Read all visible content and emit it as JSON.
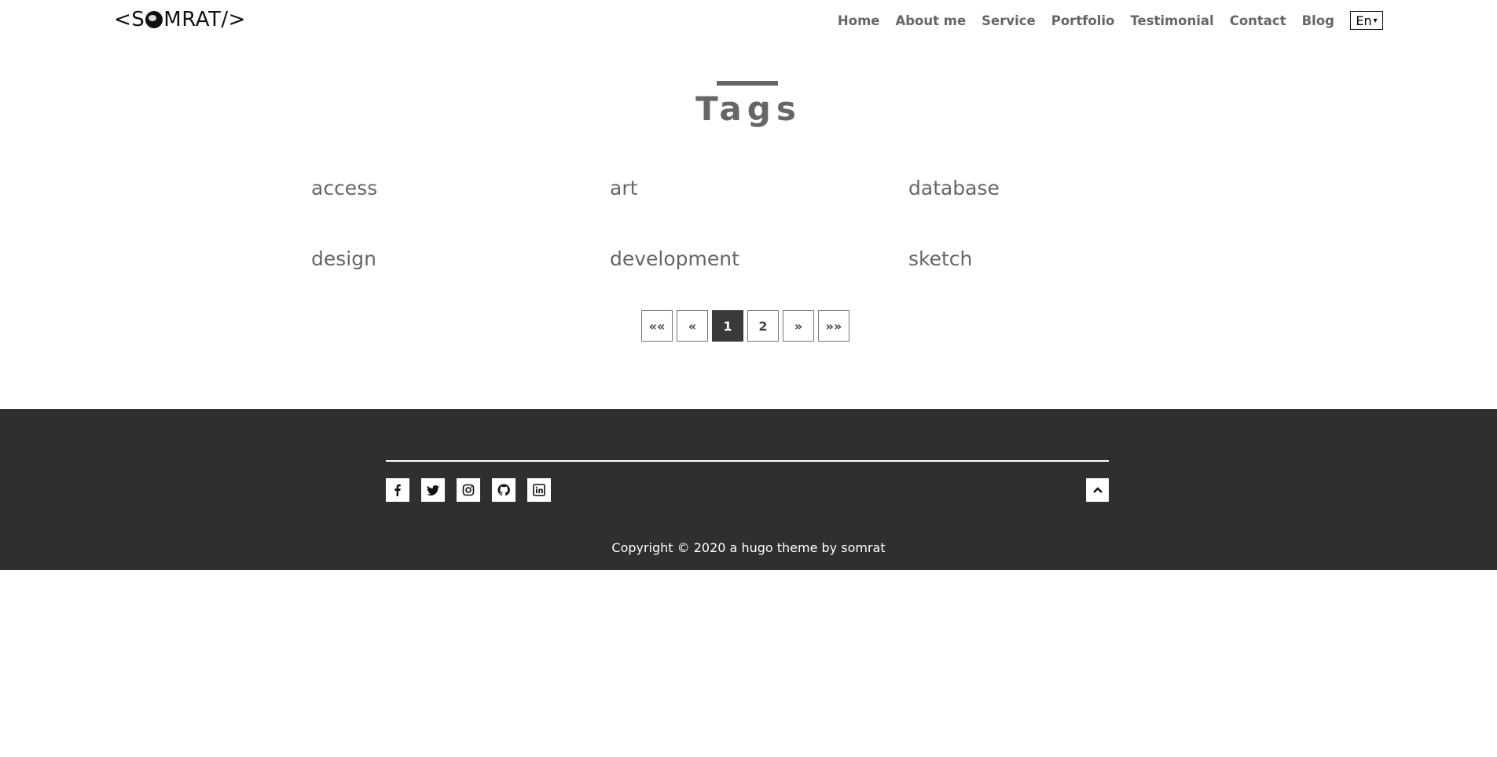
{
  "header": {
    "logo_left": "<S",
    "logo_right": "MRAT/>",
    "nav": [
      "Home",
      "About me",
      "Service",
      "Portfolio",
      "Testimonial",
      "Contact",
      "Blog"
    ],
    "language": "En"
  },
  "main": {
    "title": "Tags",
    "tags": [
      "access",
      "art",
      "database",
      "design",
      "development",
      "sketch"
    ]
  },
  "pagination": {
    "first": "««",
    "prev": "«",
    "pages": [
      "1",
      "2"
    ],
    "current": "1",
    "next": "»",
    "last": "»»"
  },
  "footer": {
    "socials": [
      "facebook-icon",
      "twitter-icon",
      "instagram-icon",
      "github-icon",
      "linkedin-icon"
    ],
    "copyright": "Copyright © 2020 a hugo theme by somrat"
  }
}
